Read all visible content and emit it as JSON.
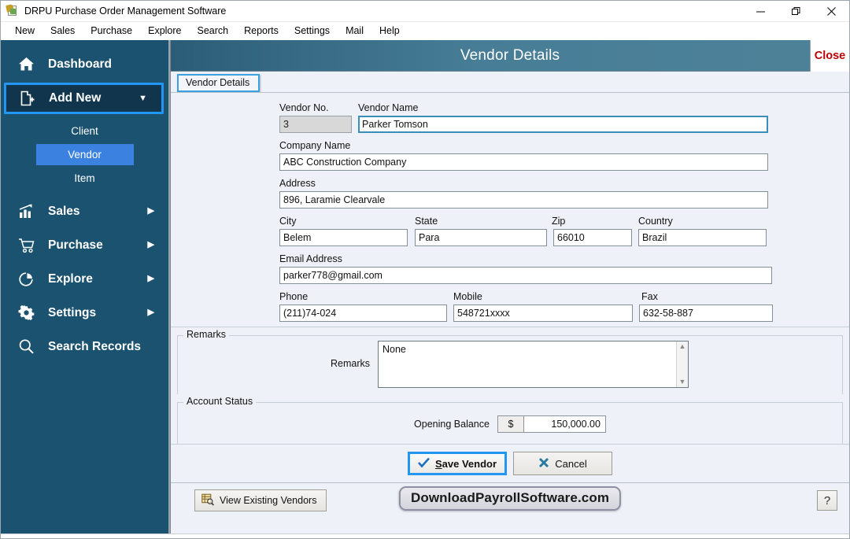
{
  "window": {
    "title": "DRPU Purchase Order Management Software",
    "app_icon": "document-stamp-icon",
    "controls": {
      "minimize": "minimize-icon",
      "maximize": "restore-icon",
      "close": "close-icon"
    }
  },
  "menubar": {
    "items": [
      {
        "label": "New"
      },
      {
        "label": "Sales"
      },
      {
        "label": "Purchase"
      },
      {
        "label": "Explore"
      },
      {
        "label": "Search"
      },
      {
        "label": "Reports"
      },
      {
        "label": "Settings"
      },
      {
        "label": "Mail"
      },
      {
        "label": "Help"
      }
    ]
  },
  "sidebar": {
    "background": "#1b5270",
    "highlight": "#3b82e0",
    "focus_border": "#2196f3",
    "items": [
      {
        "label": "Dashboard",
        "icon": "home-icon",
        "arrow": "",
        "state": "normal"
      },
      {
        "label": "Add New",
        "icon": "add-document-icon",
        "arrow": "chevron-down-icon",
        "state": "focused-expanded"
      },
      {
        "label": "Sales",
        "icon": "bar-chart-icon",
        "arrow": "chevron-right-icon",
        "state": "normal"
      },
      {
        "label": "Purchase",
        "icon": "shopping-cart-icon",
        "arrow": "chevron-right-icon",
        "state": "normal"
      },
      {
        "label": "Explore",
        "icon": "pie-chart-icon",
        "arrow": "chevron-right-icon",
        "state": "normal"
      },
      {
        "label": "Settings",
        "icon": "gear-icon",
        "arrow": "chevron-right-icon",
        "state": "normal"
      },
      {
        "label": "Search Records",
        "icon": "search-icon",
        "arrow": "",
        "state": "normal"
      }
    ],
    "subitems": [
      {
        "label": "Client",
        "active": false
      },
      {
        "label": "Vendor",
        "active": true
      },
      {
        "label": "Item",
        "active": false
      }
    ]
  },
  "panel": {
    "title": "Vendor Details",
    "close_label": "Close",
    "tab_label": "Vendor Details"
  },
  "form": {
    "vendor_no": {
      "label": "Vendor No.",
      "value": "3",
      "readonly": true
    },
    "vendor_name": {
      "label": "Vendor Name",
      "value": "Parker Tomson",
      "focused": true
    },
    "company_name": {
      "label": "Company Name",
      "value": "ABC Construction Company"
    },
    "address": {
      "label": "Address",
      "value": "896, Laramie Clearvale"
    },
    "city": {
      "label": "City",
      "value": "Belem"
    },
    "state": {
      "label": "State",
      "value": "Para"
    },
    "zip": {
      "label": "Zip",
      "value": "66010"
    },
    "country": {
      "label": "Country",
      "value": "Brazil"
    },
    "email": {
      "label": "Email Address",
      "value": "parker778@gmail.com"
    },
    "phone": {
      "label": "Phone",
      "value": "(211)74-024"
    },
    "mobile": {
      "label": "Mobile",
      "value": "548721xxxx"
    },
    "fax": {
      "label": "Fax",
      "value": "632-58-887"
    }
  },
  "remarks_section": {
    "legend": "Remarks",
    "label": "Remarks",
    "value": "None",
    "scroll_up": "chevron-up-icon",
    "scroll_down": "chevron-down-icon"
  },
  "account_status": {
    "legend": "Account Status",
    "balance_label": "Opening Balance",
    "currency_symbol": "$",
    "balance_value": "150,000.00"
  },
  "actions": {
    "save": {
      "label_prefix": "S",
      "label_rest": "ave Vendor",
      "icon": "checkmark-icon",
      "focused": true
    },
    "cancel": {
      "label": "Cancel",
      "icon": "x-mark-icon"
    }
  },
  "footer": {
    "view_existing": {
      "label": "View Existing Vendors",
      "icon": "table-search-icon"
    },
    "watermark": "DownloadPayrollSoftware.com",
    "help": {
      "label": "?",
      "icon": "question-mark-icon"
    }
  }
}
